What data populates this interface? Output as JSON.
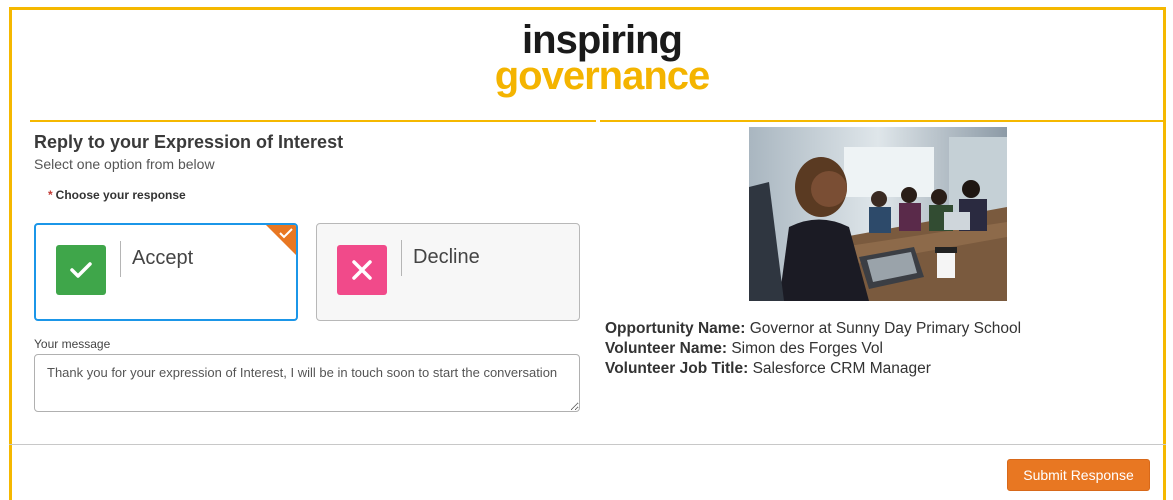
{
  "logo": {
    "line1": "inspiring",
    "line2": "governance"
  },
  "form": {
    "title": "Reply to your Expression of Interest",
    "subtitle": "Select one option from below",
    "required_mark": "*",
    "choose_label": "Choose your response",
    "options": [
      {
        "label": "Accept",
        "selected": true,
        "color": "#3fa64a"
      },
      {
        "label": "Decline",
        "selected": false,
        "color": "#f14a8a"
      }
    ],
    "message_label": "Your message",
    "message_value": "Thank you for your expression of Interest, I will be in touch soon to start the conversation"
  },
  "details": [
    {
      "key": "Opportunity Name:",
      "value": "Governor at Sunny Day Primary School"
    },
    {
      "key": "Volunteer Name:",
      "value": "Simon des Forges Vol"
    },
    {
      "key": "Volunteer Job Title:",
      "value": "Salesforce CRM Manager"
    }
  ],
  "submit_label": "Submit Response",
  "colors": {
    "border": "#f5b800",
    "accent": "#e87722",
    "selected": "#1b96e8"
  },
  "icons": {
    "accept": "check-icon",
    "decline": "close-icon",
    "selected": "corner-check-icon"
  }
}
